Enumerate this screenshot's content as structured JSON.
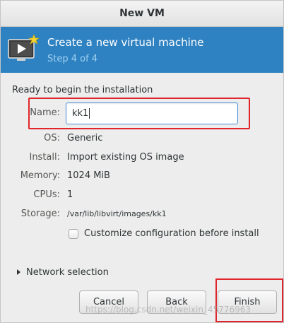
{
  "window": {
    "title": "New VM"
  },
  "banner": {
    "title": "Create a new virtual machine",
    "step": "Step 4 of 4",
    "icon": "vm-monitor-star-icon"
  },
  "summary": {
    "heading": "Ready to begin the installation",
    "name_label": "Name:",
    "name_value": "kk1",
    "os_label": "OS:",
    "os_value": "Generic",
    "install_label": "Install:",
    "install_value": "Import existing OS image",
    "memory_label": "Memory:",
    "memory_value": "1024 MiB",
    "cpus_label": "CPUs:",
    "cpus_value": "1",
    "storage_label": "Storage:",
    "storage_value": "/var/lib/libvirt/images/kk1"
  },
  "options": {
    "customize_label": "Customize configuration before install",
    "customize_checked": false
  },
  "network": {
    "expander_label": "Network selection"
  },
  "buttons": {
    "cancel": "Cancel",
    "back": "Back",
    "finish": "Finish"
  },
  "watermark": "https://blog.csdn.net/weixin_45776963",
  "colors": {
    "banner": "#2f82c2",
    "highlight": "#e0262c",
    "focus": "#4a90d9"
  }
}
